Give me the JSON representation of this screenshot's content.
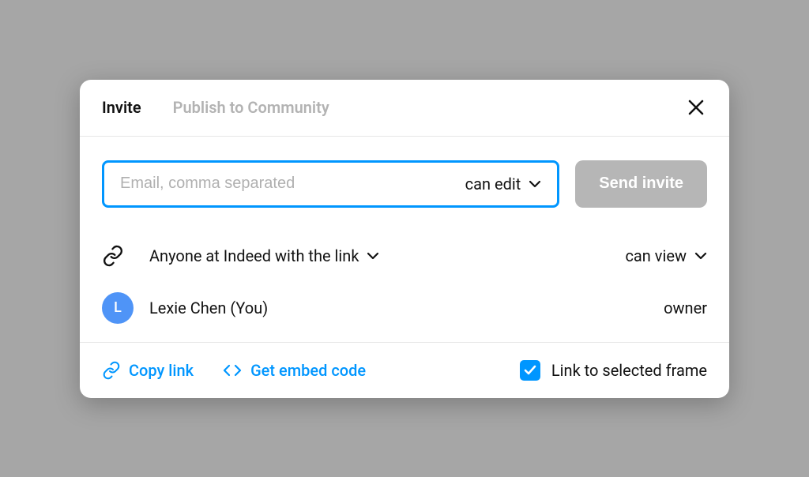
{
  "tabs": {
    "invite": "Invite",
    "publish": "Publish to Community"
  },
  "invite": {
    "email_placeholder": "Email, comma separated",
    "permission": "can edit",
    "send_button": "Send invite"
  },
  "link_sharing": {
    "description": "Anyone at Indeed with the link",
    "permission": "can view"
  },
  "user": {
    "initial": "L",
    "name": "Lexie Chen (You)",
    "role": "owner"
  },
  "footer": {
    "copy_link": "Copy link",
    "embed_code": "Get embed code",
    "link_frame": "Link to selected frame"
  },
  "colors": {
    "accent": "#0096ff",
    "avatar": "#4f94f7",
    "disabled": "#b6b6b6"
  }
}
